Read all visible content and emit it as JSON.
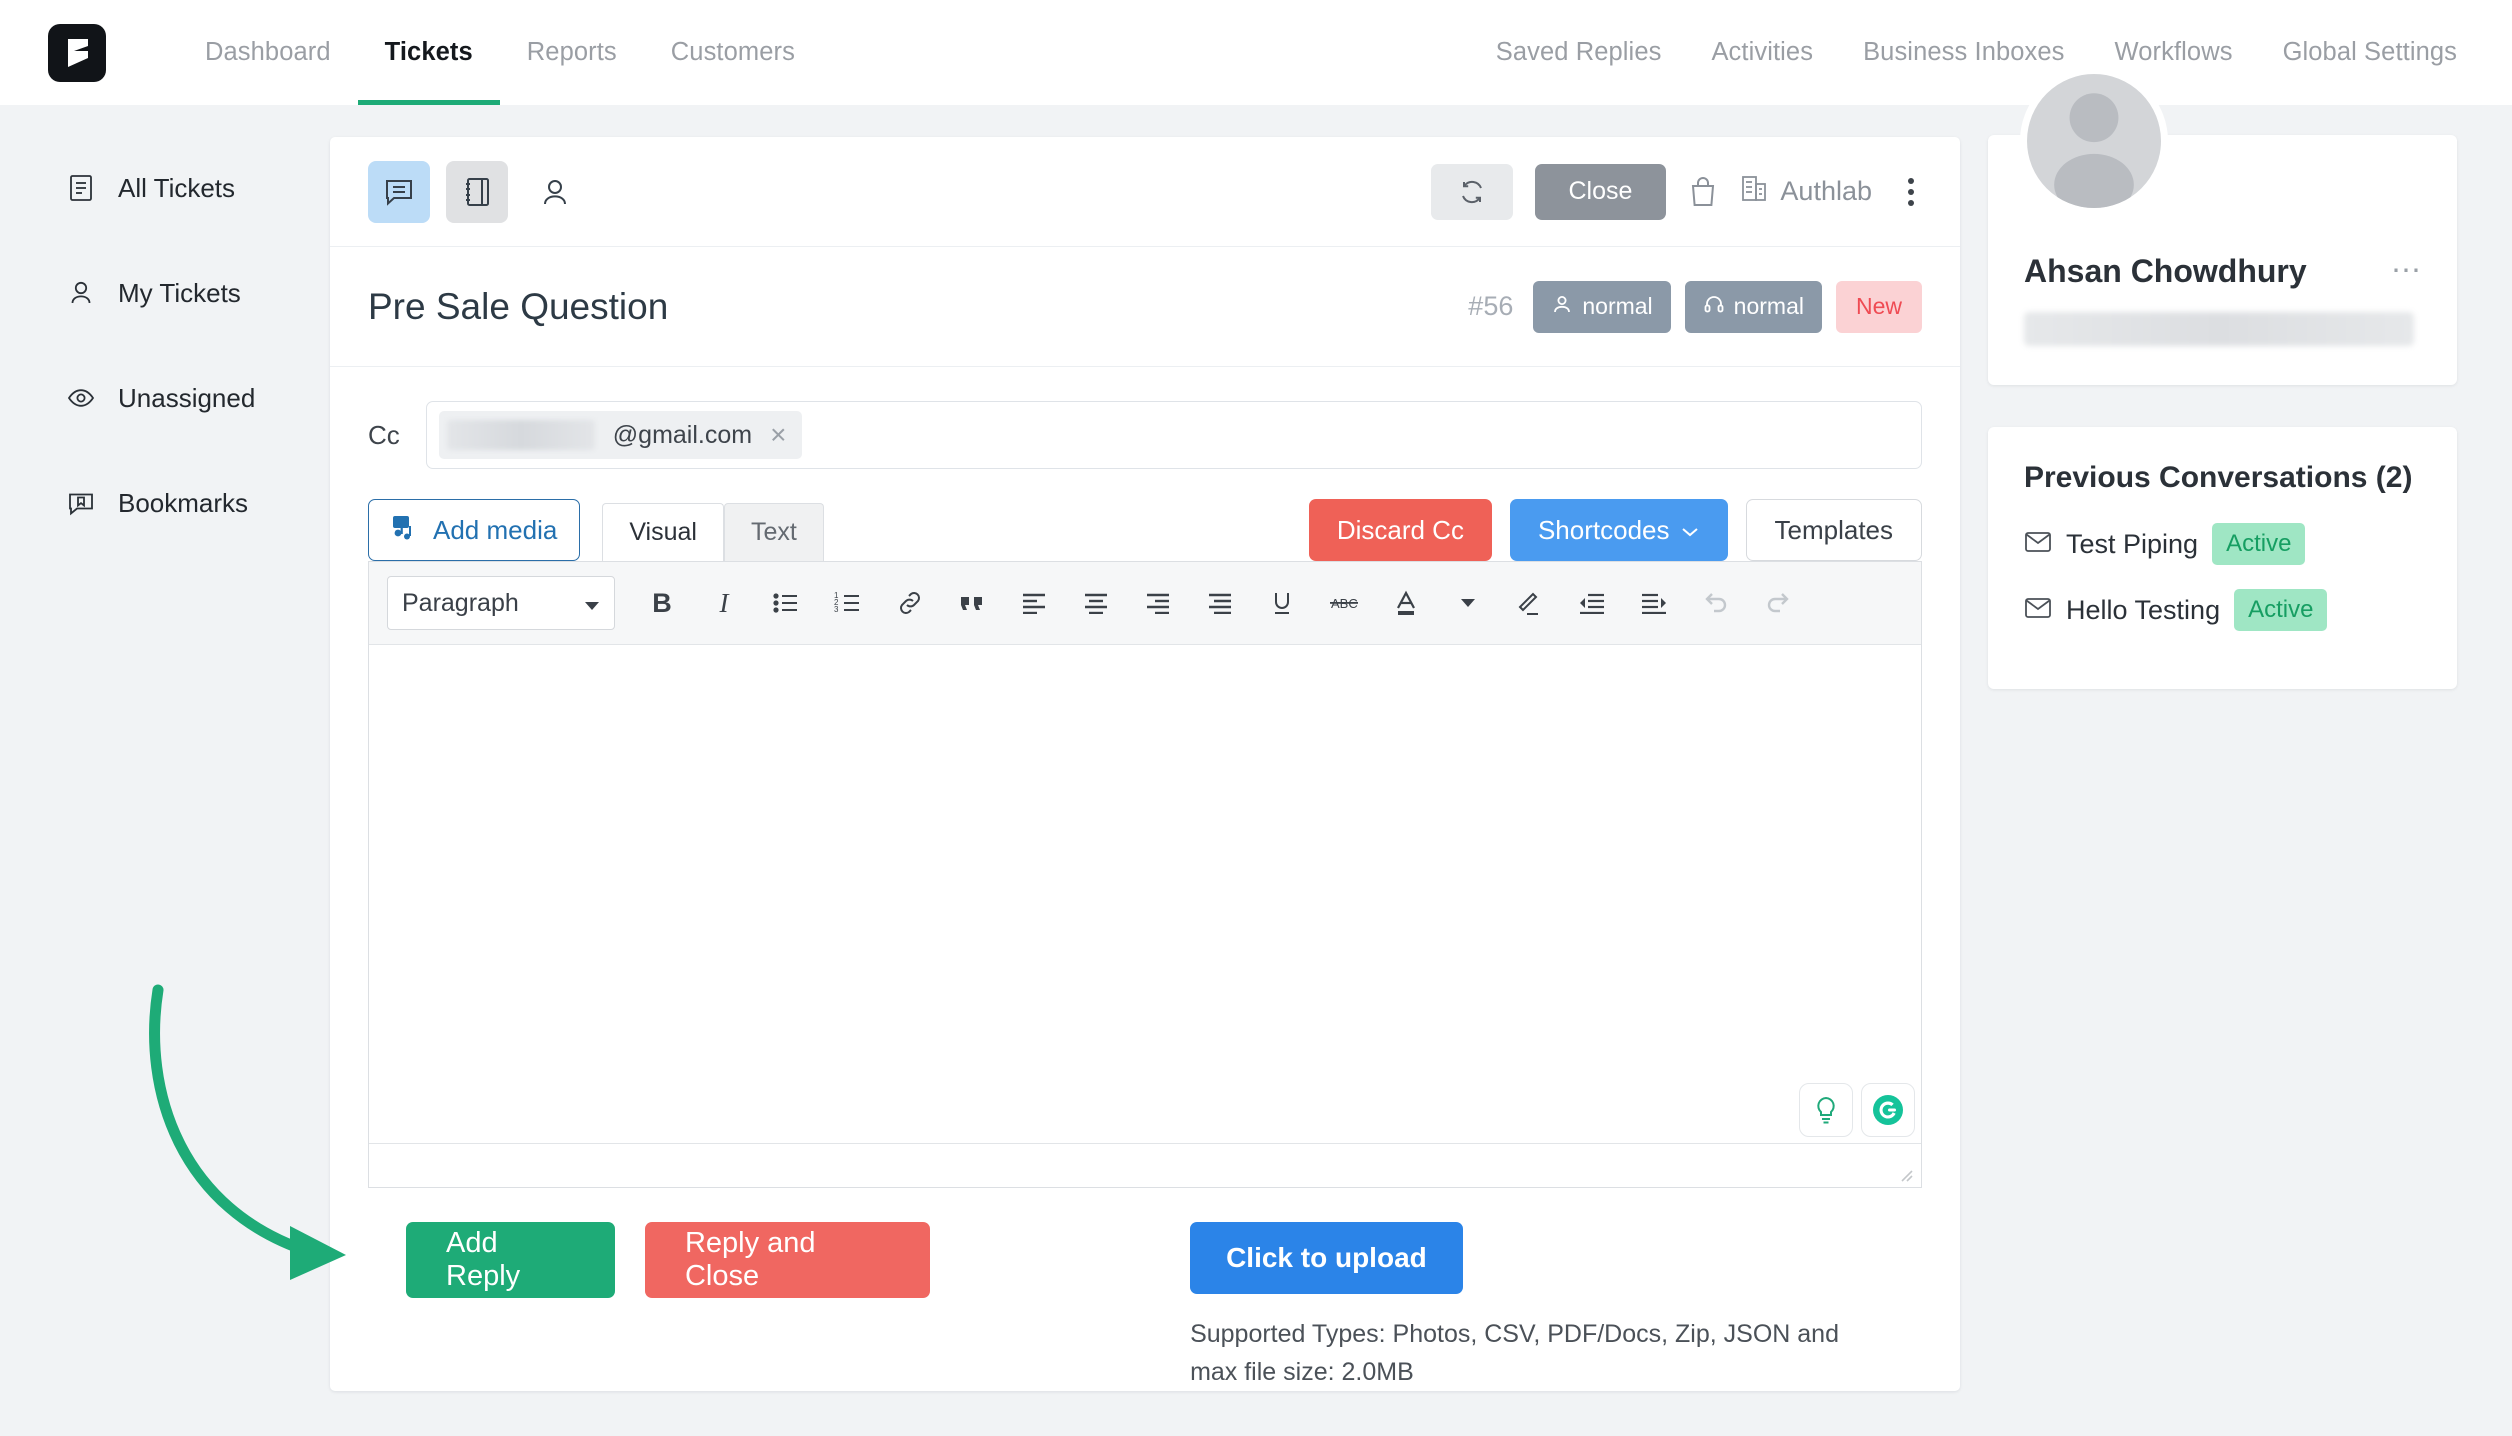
{
  "topnav": {
    "logo_icon": "fluent-support-logo-icon",
    "left_items": [
      {
        "label": "Dashboard",
        "active": false
      },
      {
        "label": "Tickets",
        "active": true
      },
      {
        "label": "Reports",
        "active": false
      },
      {
        "label": "Customers",
        "active": false
      }
    ],
    "right_items": [
      {
        "label": "Saved Replies"
      },
      {
        "label": "Activities"
      },
      {
        "label": "Business Inboxes"
      },
      {
        "label": "Workflows"
      },
      {
        "label": "Global Settings"
      }
    ],
    "active_accent": "#1eab77"
  },
  "sidebar": {
    "items": [
      {
        "label": "All Tickets",
        "icon": "document-list-icon"
      },
      {
        "label": "My Tickets",
        "icon": "person-icon"
      },
      {
        "label": "Unassigned",
        "icon": "eye-icon"
      },
      {
        "label": "Bookmarks",
        "icon": "bookmark-chat-icon"
      }
    ]
  },
  "ticket": {
    "toolbar": {
      "view_conversation_icon": "chat-bubble-icon",
      "view_notes_icon": "notebook-icon",
      "view_customer_icon": "person-icon",
      "refresh_icon": "refresh-icon",
      "close_label": "Close",
      "bag_icon": "shopping-bag-icon",
      "org_icon": "building-icon",
      "org_label": "Authlab",
      "more_icon": "kebab-menu-icon"
    },
    "title": "Pre Sale Question",
    "number": "#56",
    "badges": [
      {
        "label": "normal",
        "icon": "person-icon",
        "type": "priority"
      },
      {
        "label": "normal",
        "icon": "headset-icon",
        "type": "support"
      },
      {
        "label": "New",
        "type": "status"
      }
    ],
    "status_colors": {
      "badge_gray": "#8b99a8",
      "new_bg": "#fbd2d4",
      "new_text": "#ef4b53"
    }
  },
  "compose": {
    "cc_label": "Cc",
    "cc_chip_email": "@gmail.com",
    "cc_chip_remove_icon": "close-icon",
    "add_media_label": "Add media",
    "add_media_icon": "media-icon",
    "tabs": [
      {
        "label": "Visual",
        "active": true
      },
      {
        "label": "Text",
        "active": false
      }
    ],
    "discard_cc_label": "Discard Cc",
    "shortcodes_label": "Shortcodes",
    "shortcodes_caret_icon": "chevron-down-icon",
    "templates_label": "Templates",
    "format_select_value": "Paragraph",
    "format_select_caret_icon": "caret-down-icon",
    "toolbar_icons": [
      "bold-icon",
      "italic-icon",
      "bulleted-list-icon",
      "numbered-list-icon",
      "link-icon",
      "blockquote-icon",
      "align-left-icon",
      "align-center-icon",
      "align-right-icon",
      "align-justify-icon",
      "underline-icon",
      "strikethrough-icon",
      "text-color-icon",
      "text-color-caret-icon",
      "clear-formatting-icon",
      "outdent-icon",
      "indent-icon",
      "undo-icon",
      "redo-icon"
    ],
    "editor_body": "",
    "addon_icons": [
      "lightbulb-icon",
      "grammarly-icon"
    ],
    "resize_icon": "resize-grip-icon"
  },
  "actions": {
    "add_reply_label": "Add Reply",
    "reply_and_close_label": "Reply and Close",
    "upload_label": "Click to upload",
    "upload_hint": "Supported Types: Photos, CSV, PDF/Docs, Zip, JSON and max file size: 2.0MB",
    "arrow_annotation_color": "#1eab77"
  },
  "customer": {
    "avatar_icon": "avatar-placeholder-icon",
    "name": "Ahsan Chowdhury",
    "email_redacted": true,
    "more_icon": "ellipsis-icon"
  },
  "previous_conversations": {
    "title": "Previous Conversations (2)",
    "items": [
      {
        "icon": "envelope-icon",
        "name": "Test Piping",
        "status": "Active"
      },
      {
        "icon": "envelope-icon",
        "name": "Hello Testing",
        "status": "Active"
      }
    ],
    "status_bg": "#9fe6c4",
    "status_color": "#169e62"
  }
}
